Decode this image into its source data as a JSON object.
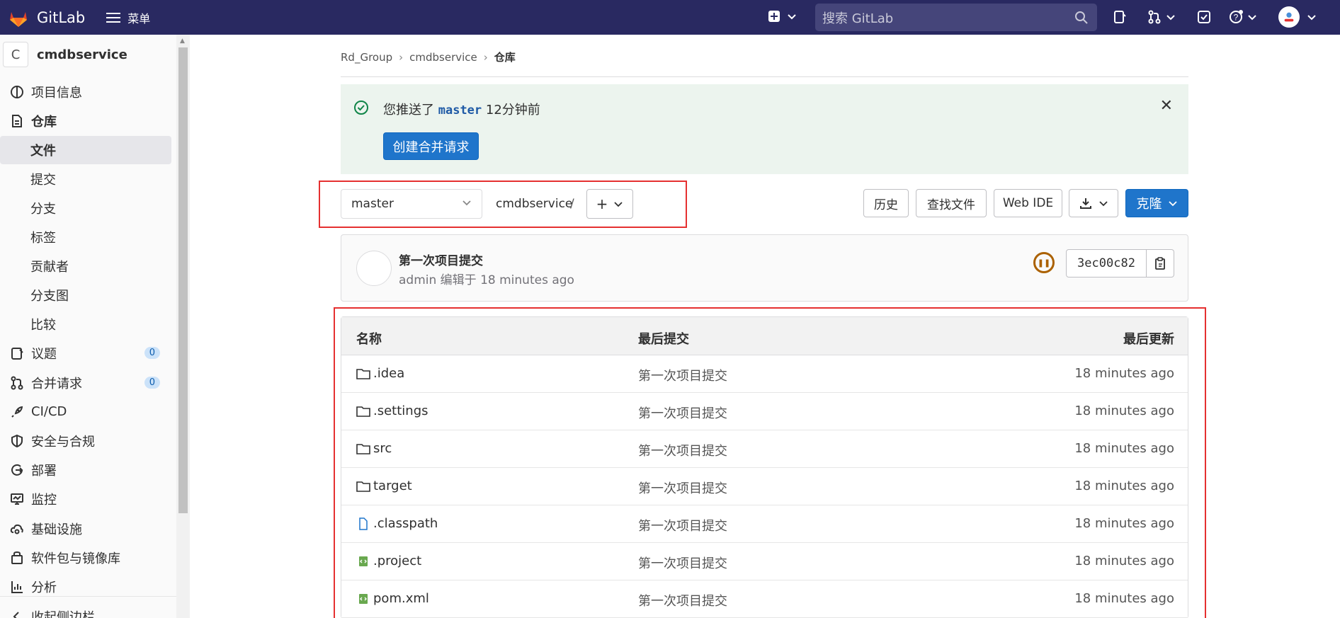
{
  "topnav": {
    "brand": "GitLab",
    "menu_label": "菜单",
    "search_placeholder": "搜索 GitLab"
  },
  "sidebar": {
    "project_initial": "C",
    "project_name": "cmdbservice",
    "items": [
      {
        "label": "项目信息",
        "icon": "info-icon"
      },
      {
        "label": "仓库",
        "icon": "document-icon"
      },
      {
        "label": "议题",
        "icon": "issues-icon",
        "count": "0"
      },
      {
        "label": "合并请求",
        "icon": "merge-request-icon",
        "count": "0"
      },
      {
        "label": "CI/CD",
        "icon": "rocket-icon"
      },
      {
        "label": "安全与合规",
        "icon": "shield-icon"
      },
      {
        "label": "部署",
        "icon": "deployments-icon"
      },
      {
        "label": "监控",
        "icon": "monitor-icon"
      },
      {
        "label": "基础设施",
        "icon": "cloud-gear-icon"
      },
      {
        "label": "软件包与镜像库",
        "icon": "package-icon"
      },
      {
        "label": "分析",
        "icon": "chart-icon"
      },
      {
        "label": "收起侧边栏",
        "icon": "collapse-icon"
      }
    ],
    "repo_subitems": [
      "文件",
      "提交",
      "分支",
      "标签",
      "贡献者",
      "分支图",
      "比较"
    ]
  },
  "breadcrumb": [
    "Rd_Group",
    "cmdbservice",
    "仓库"
  ],
  "alert": {
    "prefix": "您推送了",
    "branch": "master",
    "suffix": "12分钟前",
    "button": "创建合并请求"
  },
  "toolbar": {
    "branch": "master",
    "path": "cmdbservice",
    "path_sep": "/",
    "history": "历史",
    "find_file": "查找文件",
    "web_ide": "Web IDE",
    "clone": "克隆"
  },
  "commit": {
    "title": "第一次项目提交",
    "meta": "admin 编辑于 18 minutes ago",
    "sha": "3ec00c82"
  },
  "files": {
    "headers": [
      "名称",
      "最后提交",
      "最后更新"
    ],
    "rows": [
      {
        "name": ".idea",
        "type": "folder",
        "commit": "第一次项目提交",
        "updated": "18 minutes ago"
      },
      {
        "name": ".settings",
        "type": "folder",
        "commit": "第一次项目提交",
        "updated": "18 minutes ago"
      },
      {
        "name": "src",
        "type": "folder",
        "commit": "第一次项目提交",
        "updated": "18 minutes ago"
      },
      {
        "name": "target",
        "type": "folder",
        "commit": "第一次项目提交",
        "updated": "18 minutes ago"
      },
      {
        "name": ".classpath",
        "type": "file",
        "commit": "第一次项目提交",
        "updated": "18 minutes ago"
      },
      {
        "name": ".project",
        "type": "file-green",
        "commit": "第一次项目提交",
        "updated": "18 minutes ago"
      },
      {
        "name": "pom.xml",
        "type": "file-green",
        "commit": "第一次项目提交",
        "updated": "18 minutes ago"
      }
    ]
  },
  "colors": {
    "navbar": "#292961",
    "primary": "#1f75cb",
    "alert_bg": "#ecf4ee",
    "highlight_box": "#e53030"
  }
}
